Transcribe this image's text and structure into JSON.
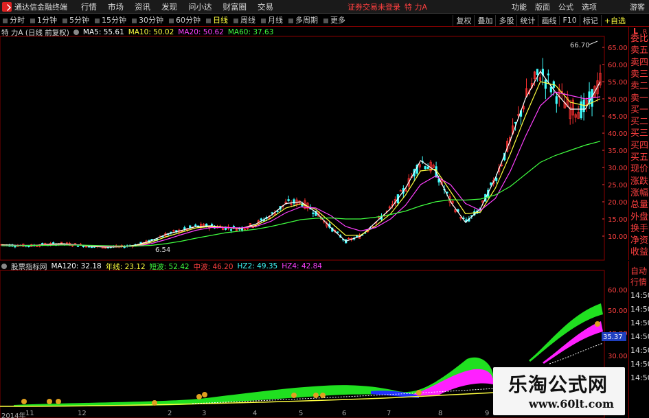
{
  "menubar": {
    "app_title": "通达信金融终端",
    "items": [
      "行情",
      "市场",
      "资讯",
      "发现",
      "问小达",
      "财富圈",
      "交易"
    ],
    "login_status": "证券交易未登录",
    "stock_name": "特 力A",
    "right_items": [
      "功能",
      "版面",
      "公式",
      "选项"
    ],
    "guest": "游客"
  },
  "periods": [
    {
      "label": "分时",
      "active": false
    },
    {
      "label": "1分钟",
      "active": false
    },
    {
      "label": "5分钟",
      "active": false
    },
    {
      "label": "15分钟",
      "active": false
    },
    {
      "label": "30分钟",
      "active": false
    },
    {
      "label": "60分钟",
      "active": false
    },
    {
      "label": "日线",
      "active": true
    },
    {
      "label": "周线",
      "active": false
    },
    {
      "label": "月线",
      "active": false
    },
    {
      "label": "多周期",
      "active": false
    },
    {
      "label": "更多",
      "active": false
    }
  ],
  "toolbar": [
    "复权",
    "叠加",
    "多股",
    "统计",
    "画线",
    "F10",
    "标记",
    "+自选"
  ],
  "main_legend": {
    "title": "特 力A (日线 前复权)",
    "items": [
      {
        "label": "MA5: 55.61",
        "color": "#ffffff"
      },
      {
        "label": "MA10: 50.02",
        "color": "#ffff40"
      },
      {
        "label": "MA20: 50.62",
        "color": "#ff40ff"
      },
      {
        "label": "MA60: 37.63",
        "color": "#40ff40"
      }
    ]
  },
  "indicator_legend": {
    "title": "股票指标网",
    "items": [
      {
        "label": "MA120: 32.18",
        "color": "#ffffff"
      },
      {
        "label": "年线: 23.12",
        "color": "#ffff40"
      },
      {
        "label": "短波: 52.42",
        "color": "#40ff40"
      },
      {
        "label": "中波: 46.20",
        "color": "#ff4040"
      },
      {
        "label": "HZ2: 49.35",
        "color": "#40ffff"
      },
      {
        "label": "HZ4: 42.84",
        "color": "#ff40ff"
      }
    ]
  },
  "main_price_axis": [
    "65.00",
    "60.00",
    "55.00",
    "50.00",
    "45.00",
    "40.00",
    "35.00",
    "30.00",
    "25.00",
    "20.00",
    "15.00",
    "10.00"
  ],
  "indicator_axis": [
    "60.00",
    "50.00",
    "40.00",
    "30.00"
  ],
  "indicator_current": "35.37",
  "max_label": "66.70",
  "min_label": "6.54",
  "side_labels": [
    "委比",
    "卖五",
    "卖四",
    "卖三",
    "卖二",
    "卖一",
    "买一",
    "买二",
    "买三",
    "买四",
    "买五",
    "现价",
    "涨跌",
    "涨幅",
    "总量",
    "外盘",
    "换手",
    "净资",
    "收益"
  ],
  "side_labels2": [
    "自动",
    "行情"
  ],
  "side_times": [
    "14:50",
    "14:50",
    "14:50",
    "14:50",
    "14:50",
    "14:50",
    "14:50"
  ],
  "date_ticks": [
    "2014年",
    "11",
    "12",
    "2",
    "3",
    "4",
    "5",
    "6",
    "7",
    "8",
    "9"
  ],
  "corner_marker": "L",
  "corner_r": "R",
  "watermark": {
    "title": "乐淘公式网",
    "url": "www.60lt.com"
  },
  "chart_data": {
    "type": "line",
    "title": "特 力A (日线 前复权)",
    "ylim": [
      5,
      68
    ],
    "series": [
      {
        "name": "MA5",
        "values": [
          7.5,
          7.3,
          7.2,
          7.6,
          7.8,
          7.5,
          7.0,
          6.8,
          6.9,
          7.4,
          8.6,
          10.5,
          11.6,
          12.8,
          13.0,
          12.5,
          12.2,
          13.5,
          16,
          19.5,
          20,
          17,
          12.5,
          8.5,
          10,
          14,
          18,
          24,
          32,
          29,
          20,
          14,
          18,
          27,
          38,
          50,
          58,
          52,
          47,
          47,
          55
        ]
      },
      {
        "name": "MA10",
        "values": [
          7.4,
          7.3,
          7.3,
          7.5,
          7.6,
          7.5,
          7.1,
          6.9,
          6.9,
          7.2,
          8.2,
          9.8,
          11.1,
          12.4,
          12.8,
          12.5,
          12.3,
          13.1,
          15.2,
          18.2,
          19.4,
          17.8,
          14,
          10.2,
          10.3,
          13,
          16.5,
          22,
          29,
          29.5,
          23,
          16.5,
          17,
          24,
          34,
          45,
          55,
          54,
          49,
          48,
          50
        ]
      },
      {
        "name": "MA20",
        "values": [
          7.3,
          7.3,
          7.3,
          7.4,
          7.5,
          7.5,
          7.2,
          7.0,
          7.0,
          7.1,
          7.8,
          9.0,
          10.4,
          11.7,
          12.5,
          12.5,
          12.4,
          12.8,
          14.3,
          16.8,
          18.5,
          18.2,
          16,
          12.8,
          11.5,
          12.5,
          15,
          19,
          25,
          27.5,
          25,
          19.5,
          17.5,
          21,
          29,
          39,
          48,
          52,
          51,
          50,
          50.6
        ]
      },
      {
        "name": "MA60",
        "values": [
          7.2,
          7.2,
          7.3,
          7.3,
          7.4,
          7.4,
          7.3,
          7.2,
          7.1,
          7.1,
          7.3,
          7.8,
          8.5,
          9.4,
          10.2,
          11,
          11.5,
          12,
          12.8,
          13.8,
          14.8,
          15.2,
          15.3,
          15,
          15,
          15.5,
          16.3,
          17.3,
          18.8,
          20,
          20.6,
          20.5,
          20.8,
          22,
          24.5,
          28,
          31.5,
          33.5,
          35,
          36.5,
          37.63
        ]
      }
    ]
  }
}
